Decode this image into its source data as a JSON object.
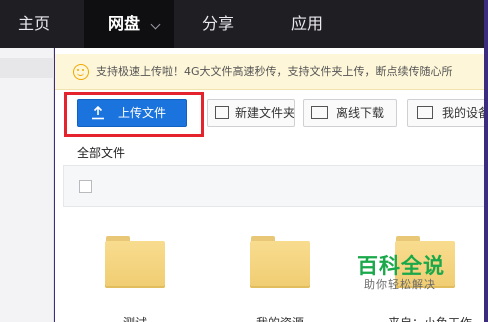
{
  "nav": {
    "home": "主页",
    "disk": "网盘",
    "share": "分享",
    "app": "应用"
  },
  "notice": {
    "text": "支持极速上传啦！4G大文件高速秒传，支持文件夹上传，断点续传随心所"
  },
  "toolbar": {
    "upload_label": "上传文件",
    "new_folder_label": "新建文件夹",
    "offline_label": "离线下载",
    "device_label": "我的设备"
  },
  "breadcrumb": {
    "label": "全部文件"
  },
  "files": [
    {
      "name": "测试"
    },
    {
      "name": "我的资源"
    },
    {
      "name": "来自：小鱼工作"
    }
  ],
  "watermark": {
    "title": "百科全说",
    "subtitle": "助你轻松解决"
  },
  "colors": {
    "accent": "#1b74de",
    "highlight": "#e4232d",
    "folder": "#f3d27a",
    "nav_bg": "#1f1f23",
    "watermark": "#1aa84a"
  }
}
